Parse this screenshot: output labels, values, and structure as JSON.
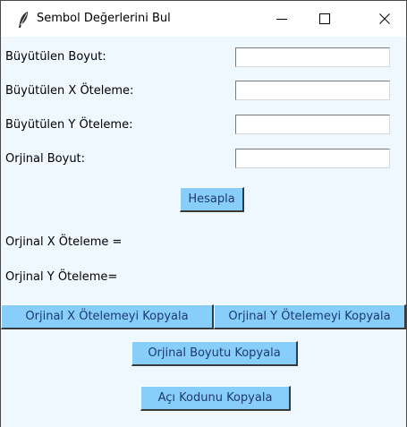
{
  "window": {
    "title": "Sembol Değerlerini Bul",
    "icon": "feather-icon",
    "controls": [
      "minimize-icon",
      "maximize-icon",
      "close-icon"
    ]
  },
  "form": {
    "fields": [
      {
        "label": "Büyütülen Boyut:",
        "value": ""
      },
      {
        "label": "Büyütülen X Öteleme:",
        "value": ""
      },
      {
        "label": "Büyütülen Y Öteleme:",
        "value": ""
      },
      {
        "label": "Orjinal Boyut:",
        "value": ""
      }
    ],
    "calculate_label": "Hesapla"
  },
  "results": {
    "x_offset_label": "Orjinal X Öteleme =",
    "y_offset_label": "Orjinal Y Öteleme="
  },
  "buttons": {
    "copy_x_label": "Orjinal X Ötelemeyi Kopyala",
    "copy_y_label": "Orjinal Y Ötelemeyi Kopyala",
    "copy_size_label": "Orjinal Boyutu Kopyala",
    "copy_angle_label": "Açı Kodunu Kopyala"
  },
  "colors": {
    "background": "#f0f8ff",
    "button": "#87cefa",
    "button_text": "#1c3a6e"
  }
}
